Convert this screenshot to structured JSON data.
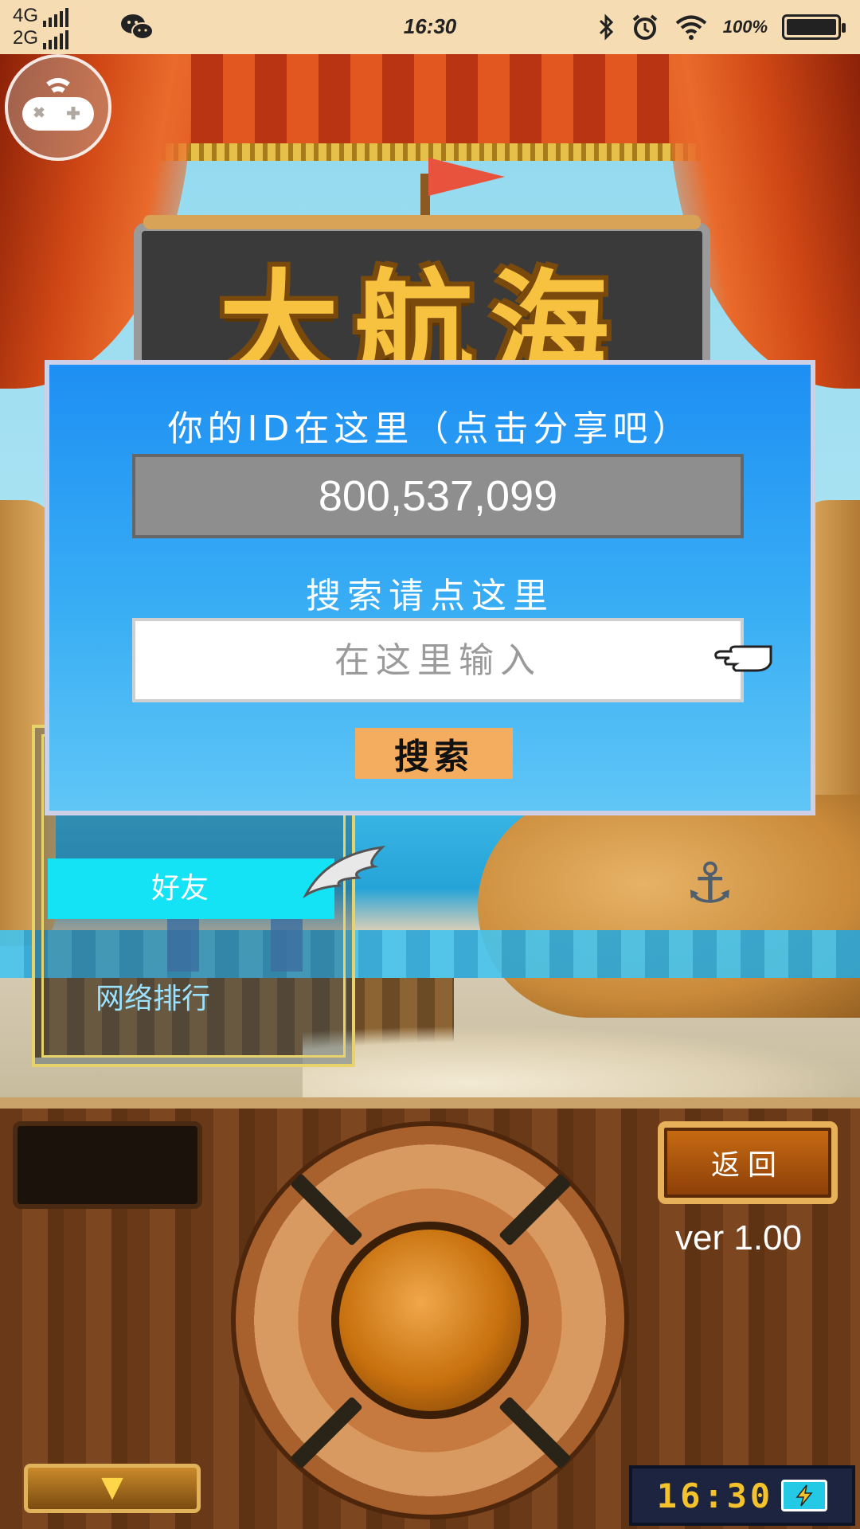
{
  "status_bar": {
    "network_top": "4G",
    "network_bottom": "2G",
    "time": "16:30",
    "battery_percent": "100",
    "battery_level": 1.0,
    "icons": [
      "signal-icon",
      "wechat-icon",
      "bluetooth-icon",
      "alarm-icon",
      "wifi-icon",
      "battery-icon"
    ]
  },
  "game": {
    "title": "大航海",
    "version": "ver 1.00",
    "clock": "16:30"
  },
  "dialog": {
    "id_label": "你的ID在这里（点击分享吧）",
    "player_id": "800,537,099",
    "search_label": "搜索请点这里",
    "search_placeholder": "在这里输入",
    "search_button": "搜索"
  },
  "friends_panel": {
    "friends_button": "好友",
    "ranking_label": "网络排行"
  },
  "controls": {
    "back_button": "返回",
    "down_button": "▼"
  },
  "colors": {
    "dialog_blue": "#1e8ff3",
    "search_button": "#f4ac5e",
    "friends_button": "#14e2f5",
    "status_bar": "#f6dcb3"
  }
}
